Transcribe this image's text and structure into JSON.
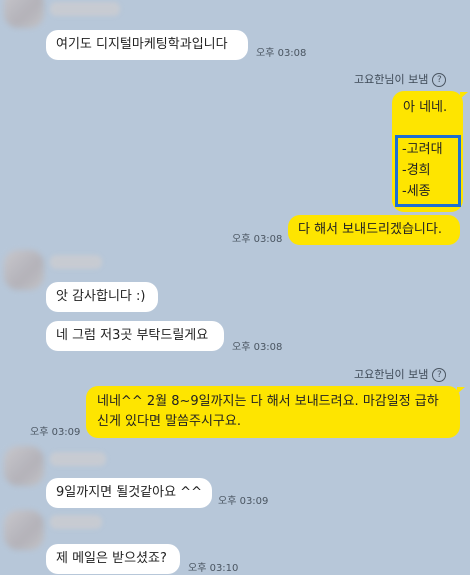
{
  "messages": {
    "m1": {
      "text": "여기도 디지털마케팅학과입니다",
      "time": "오후 03:08"
    },
    "sent1": {
      "sender_label": "고요한님이 보냄",
      "line1": "아 네네.",
      "list": [
        "-고려대",
        "-경희",
        "-세종"
      ],
      "time": "오후 03:08",
      "reply": "다 해서 보내드리겠습니다."
    },
    "m2": {
      "text": "앗 감사합니다 :)"
    },
    "m3": {
      "text": "네 그럼 저3곳 부탁드릴게요",
      "time": "오후 03:08"
    },
    "sent2": {
      "sender_label": "고요한님이 보냄",
      "line1": "네네^^ 2월 8~9일까지는 다 해서 보내드려요. 마감일정 급하",
      "line2": "신게 있다면 말씀주시구요.",
      "time": "오후 03:09"
    },
    "m4": {
      "text": "9일까지면 될것같아요 ^^",
      "time": "오후 03:09"
    },
    "m5": {
      "text": "제 메일은 받으셨죠?",
      "time": "오후 03:10"
    }
  },
  "colors": {
    "background": "#b7c7d9",
    "sent_bubble": "#fee500",
    "received_bubble": "#ffffff",
    "highlight_box": "#1e6fd1"
  }
}
